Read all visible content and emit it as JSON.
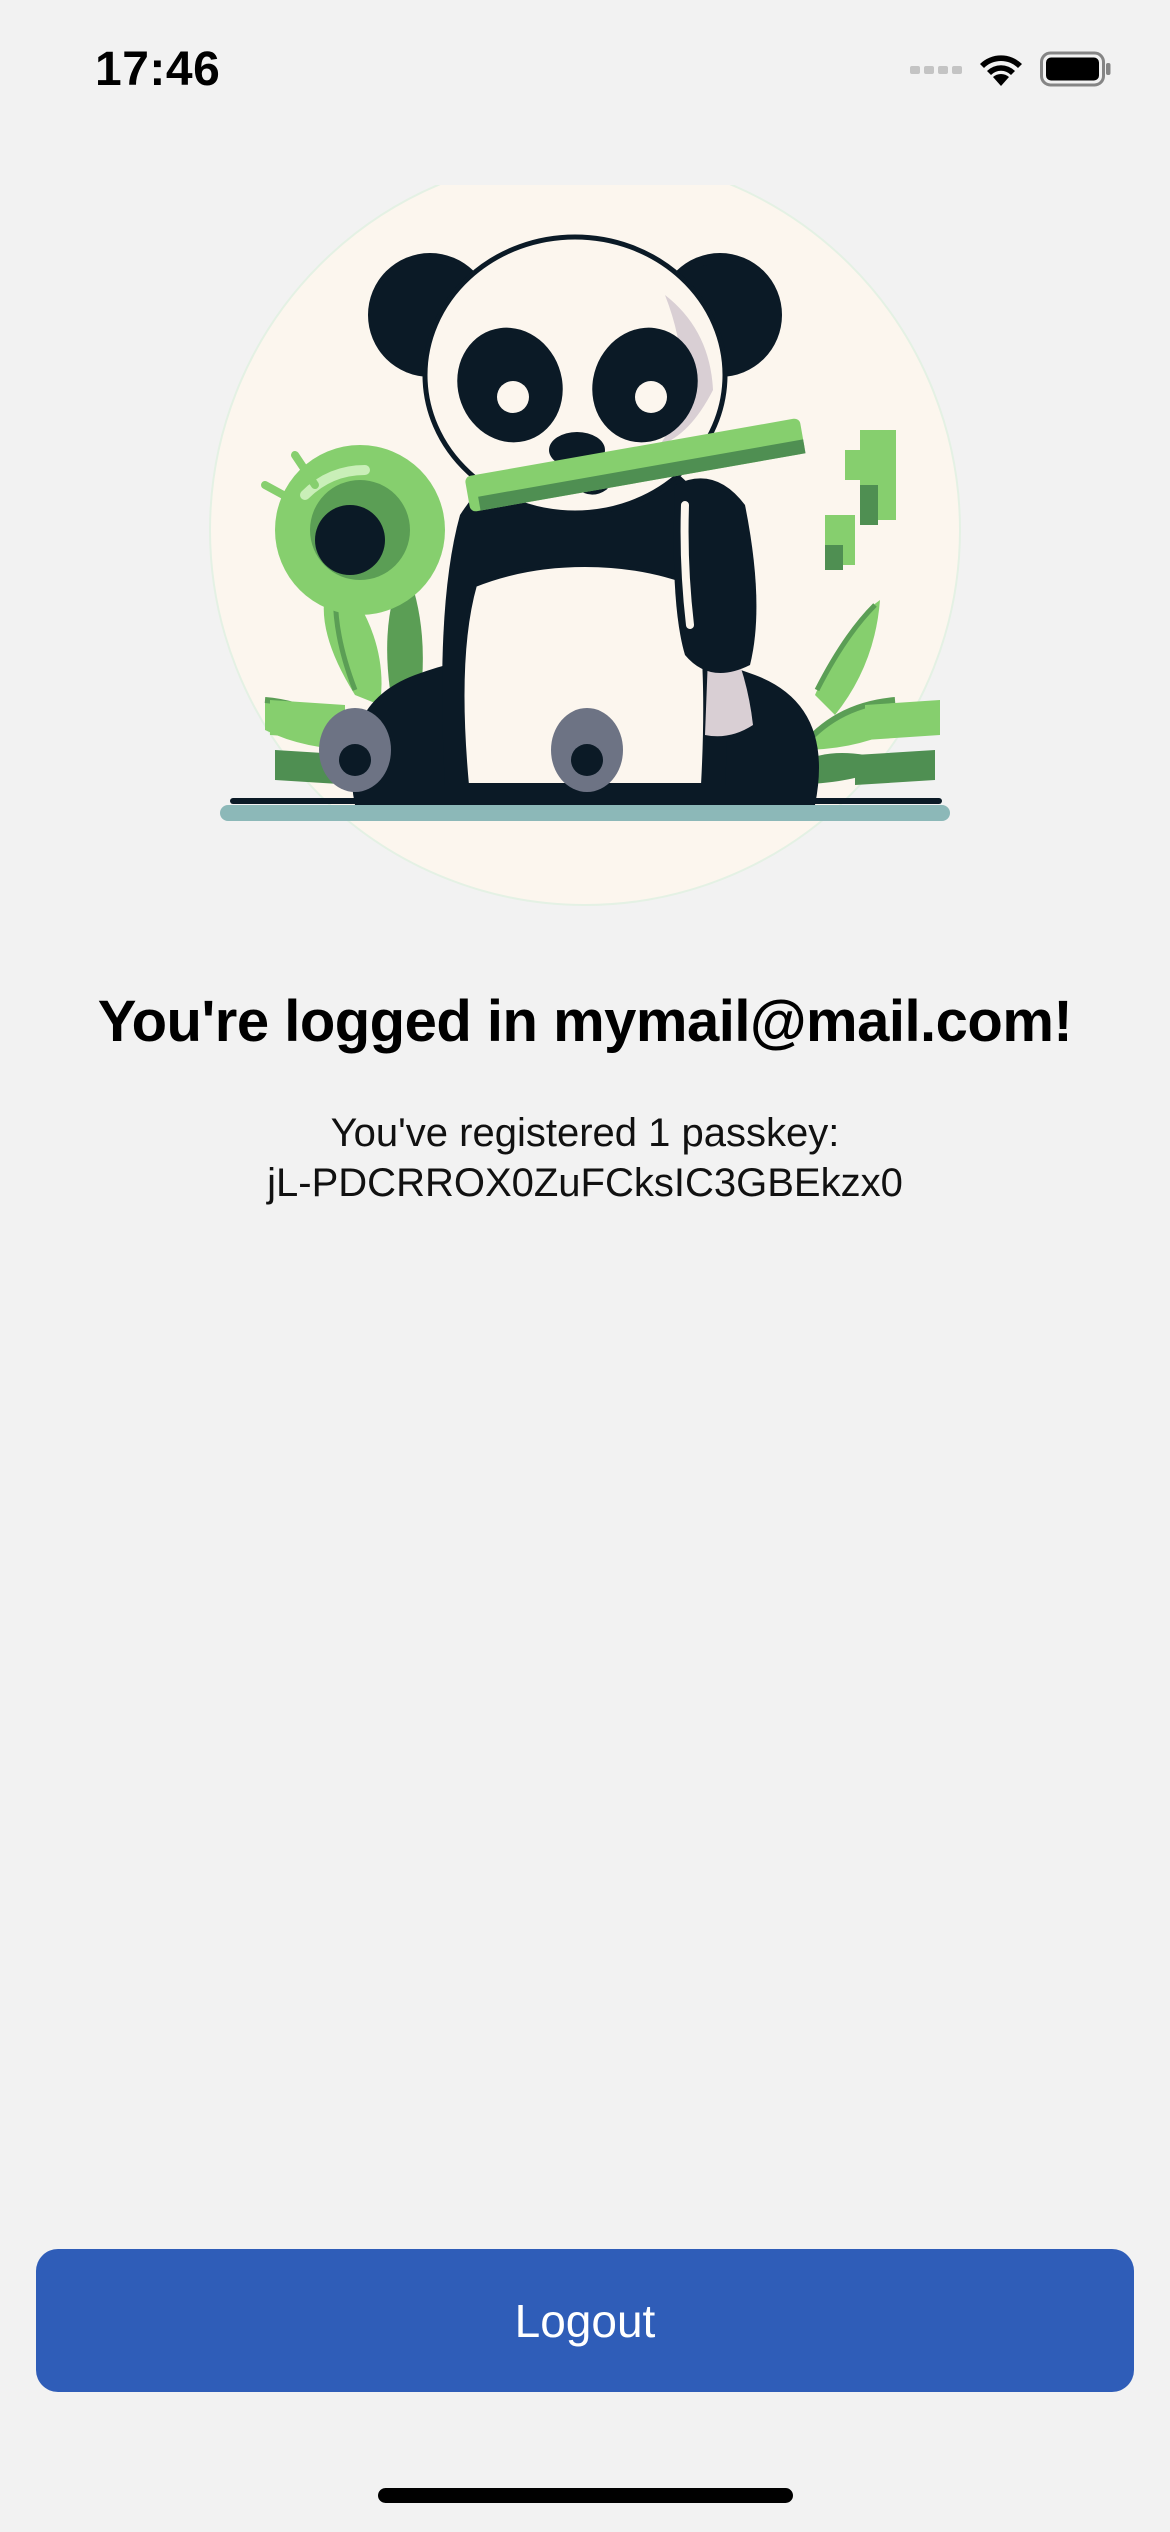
{
  "status_bar": {
    "time": "17:46",
    "icons": [
      "cellular-signal-icon",
      "wifi-icon",
      "battery-icon"
    ]
  },
  "illustration": {
    "icon": "panda-with-key-illustration"
  },
  "main": {
    "title": "You're logged in mymail@mail.com!",
    "passkey_intro": "You've registered 1 passkey:",
    "passkey_id": "jL-PDCRROX0ZuFCksIC3GBEkzx0"
  },
  "footer": {
    "logout_label": "Logout"
  },
  "colors": {
    "background": "#f2f2f2",
    "button": "#2f5db8",
    "button_text": "#ffffff",
    "key_green": "#7fce6a"
  }
}
